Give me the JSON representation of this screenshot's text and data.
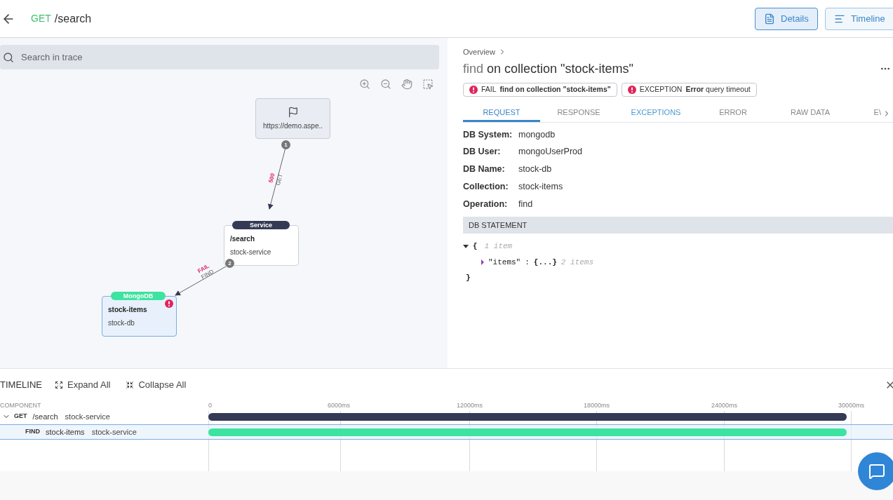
{
  "header": {
    "method": "GET",
    "path": "/search",
    "buttons": [
      {
        "label": "Details",
        "selected": true
      },
      {
        "label": "Timeline",
        "selected": false
      }
    ]
  },
  "search": {
    "placeholder": "Search in trace"
  },
  "graph": {
    "nodes": [
      {
        "kind": "client",
        "label": "https://demo.aspe..",
        "number": "1"
      },
      {
        "kind": "service",
        "badge": "Service",
        "title": "/search",
        "subtitle": "stock-service",
        "number": "2"
      },
      {
        "kind": "mongodb",
        "badge": "MongoDB",
        "title": "stock-items",
        "subtitle": "stock-db",
        "error": true,
        "selected": true
      }
    ],
    "edges": [
      {
        "status": "500",
        "method": "GET"
      },
      {
        "status": "FAIL",
        "method": "FIND"
      }
    ]
  },
  "detail": {
    "breadcrumb": "Overview",
    "title_op": "find",
    "title_rest": "on collection \"stock-items\"",
    "badges": [
      {
        "kind": "FAIL",
        "text": "**find on collection \"stock-items\"**"
      },
      {
        "kind": "EXCEPTION",
        "text": "**Error** query timeout"
      }
    ],
    "tabs": [
      {
        "label": "REQUEST",
        "selected": true,
        "hover": false
      },
      {
        "label": "RESPONSE",
        "selected": false,
        "hover": false
      },
      {
        "label": "EXCEPTIONS",
        "selected": false,
        "hover": true
      },
      {
        "label": "ERROR",
        "selected": false,
        "hover": false
      },
      {
        "label": "RAW DATA",
        "selected": false,
        "hover": false
      },
      {
        "label": "E\\",
        "selected": false,
        "hover": false
      }
    ],
    "fields": [
      {
        "label": "DB System:",
        "value": "mongodb"
      },
      {
        "label": "DB User:",
        "value": "mongoUserProd"
      },
      {
        "label": "DB Name:",
        "value": "stock-db"
      },
      {
        "label": "Collection:",
        "value": "stock-items"
      },
      {
        "label": "Operation:",
        "value": "find"
      }
    ],
    "statement": {
      "heading": "DB STATEMENT",
      "open": "{",
      "open_count": "1 item",
      "key": "\"items\"",
      "colon": ":",
      "collapsed": "{...}",
      "key_count": "2 items",
      "close": "}"
    }
  },
  "timeline": {
    "title": "TIMELINE",
    "expand": "Expand All",
    "collapse": "Collapse All",
    "column": "COMPONENT",
    "ticks": [
      "0",
      "6000ms",
      "12000ms",
      "18000ms",
      "24000ms",
      "30000ms"
    ],
    "rows": [
      {
        "kind": "parent",
        "method": "GET",
        "name": "/search",
        "service": "stock-service",
        "expanded": true,
        "selected": false,
        "color": "#353a55"
      },
      {
        "kind": "child",
        "method": "FIND",
        "name": "stock-items",
        "service": "stock-service",
        "selected": true,
        "color": "#3de3a1"
      }
    ]
  }
}
